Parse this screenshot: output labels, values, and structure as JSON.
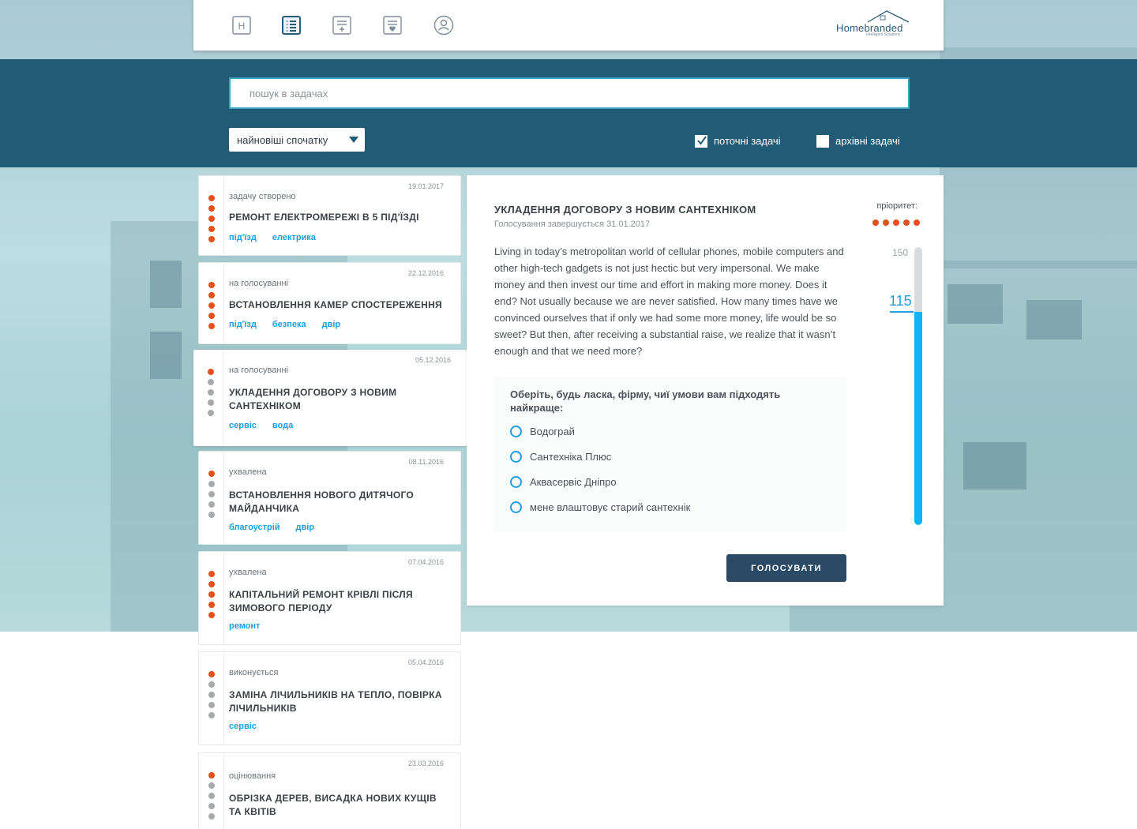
{
  "nav": {
    "icons": [
      "home-h-icon",
      "task-list-icon",
      "add-task-icon",
      "favorites-list-icon",
      "profile-icon"
    ],
    "home_letter": "H",
    "active_index": 1
  },
  "logo": {
    "name": "Homebranded",
    "tagline": "Intelligent Solutions"
  },
  "search": {
    "placeholder": "пошук в задачах",
    "value": ""
  },
  "sort": {
    "selected": "найновіші спочатку"
  },
  "filters": {
    "current": {
      "label": "поточні задачі",
      "checked": true
    },
    "archive": {
      "label": "архівні задачі",
      "checked": false
    }
  },
  "colors": {
    "band": "#225b75",
    "accent_blue": "#1c9fe0",
    "priority_orange": "#e2511c",
    "button": "#2a4a66",
    "progress": "#0fb3f6"
  },
  "tasks": [
    {
      "date": "19.01.2017",
      "status": "задачу створено",
      "title": "РЕМОНТ ЕЛЕКТРОМЕРЕЖІ В 5 ПІД'ЇЗДІ",
      "tags": [
        "під'їзд",
        "електрика"
      ],
      "priority": 5
    },
    {
      "date": "22.12.2016",
      "status": "на голосуванні",
      "title": "ВСТАНОВЛЕННЯ КАМЕР СПОСТЕРЕЖЕННЯ",
      "tags": [
        "під'їзд",
        "безпека",
        "двір"
      ],
      "priority": 5
    },
    {
      "date": "05.12.2016",
      "status": "на голосуванні",
      "title": "УКЛАДЕННЯ ДОГОВОРУ З НОВИМ САНТЕХНІКОМ",
      "tags": [
        "сервіс",
        "вода"
      ],
      "priority": 1
    },
    {
      "date": "08.11.2016",
      "status": "ухвалена",
      "title": "ВСТАНОВЛЕННЯ НОВОГО ДИТЯЧОГО МАЙДАНЧИКА",
      "tags": [
        "благоустрій",
        "двір"
      ],
      "priority": 1
    },
    {
      "date": "07.04.2016",
      "status": "ухвалена",
      "title": "КАПІТАЛЬНИЙ РЕМОНТ КРІВЛІ ПІСЛЯ ЗИМОВОГО ПЕРІОДУ",
      "tags": [
        "ремонт"
      ],
      "priority": 5
    },
    {
      "date": "05.04.2016",
      "status": "виконується",
      "title": "ЗАМІНА ЛІЧИЛЬНИКІВ НА ТЕПЛО, ПОВІРКА ЛІЧИЛЬНИКІВ",
      "tags": [
        "сервіс"
      ],
      "priority": 1
    },
    {
      "date": "23.03.2016",
      "status": "оцінювання",
      "title": "ОБРІЗКА ДЕРЕВ, ВИСАДКА НОВИХ КУЩІВ ТА КВІТІВ",
      "tags": [],
      "priority": 1
    }
  ],
  "detail": {
    "title": "УКЛАДЕННЯ ДОГОВОРУ З НОВИМ САНТЕХНІКОМ",
    "subtitle": "Голосування завершується 31.01.2017",
    "priority_label": "пріоритет:",
    "priority": 5,
    "body": "Living in today’s metropolitan world of cellular phones, mobile computers and other high-tech gadgets is not just hectic but very impersonal. We make money and then invest our time and effort in making more money. Does it end? Not usually because we are never satisfied. How many times have we convinced ourselves that if only we had some more money, life would be so sweet? But then, after receiving a substantial raise, we realize that it wasn’t enough and that we need more?",
    "poll": {
      "question": "Оберіть, будь ласка, фірму, чиї умови вам підходять найкраще:",
      "options": [
        "Водограй",
        "Сантехніка Плюс",
        "Аквасервіс Дніпро",
        "мене влаштовує старий сантехнік"
      ]
    },
    "vote_label": "ГОЛОСУВАТИ",
    "votes": {
      "max": 150,
      "current": 115
    }
  }
}
